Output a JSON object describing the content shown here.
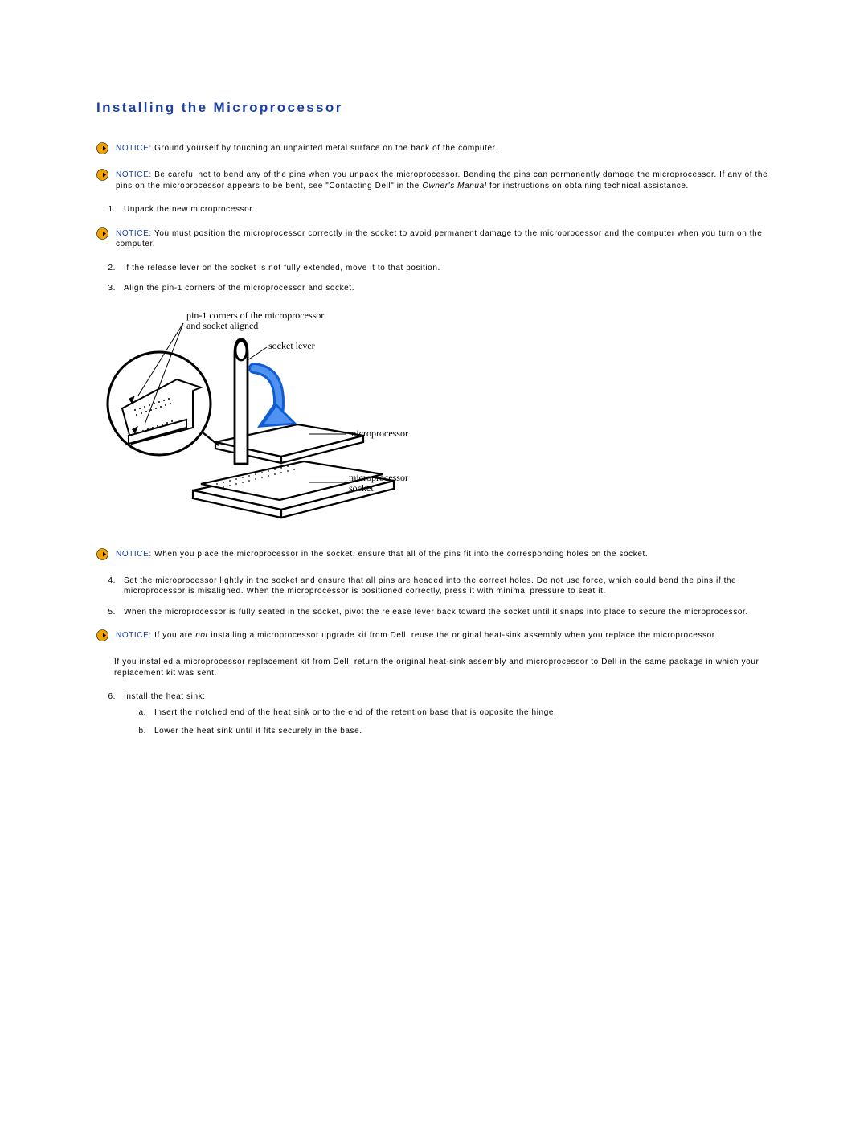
{
  "title": "Installing the Microprocessor",
  "notices": {
    "label": "NOTICE:",
    "n1": "Ground yourself by touching an unpainted metal surface on the back of the computer.",
    "n2_a": "Be careful not to bend any of the pins when you unpack the microprocessor. Bending the pins can permanently damage the microprocessor. If any of the pins on the microprocessor appears to be bent, see \"Contacting Dell\" in the ",
    "n2_em": "Owner's Manual",
    "n2_b": " for instructions on obtaining technical assistance.",
    "n3": "You must position the microprocessor correctly in the socket to avoid permanent damage to the microprocessor and the computer when you turn on the computer.",
    "n4": "When you place the microprocessor in the socket, ensure that all of the pins fit into the corresponding holes on the socket.",
    "n5_a": "If you are ",
    "n5_em": "not",
    "n5_b": " installing a microprocessor upgrade kit from Dell, reuse the original heat-sink assembly when you replace the microprocessor."
  },
  "steps": {
    "s1": {
      "n": "1.",
      "t": "Unpack the new microprocessor."
    },
    "s2": {
      "n": "2.",
      "t": "If the release lever on the socket is not fully extended, move it to that position."
    },
    "s3": {
      "n": "3.",
      "t": "Align the pin-1 corners of the microprocessor and socket."
    },
    "s4": {
      "n": "4.",
      "t": "Set the microprocessor lightly in the socket and ensure that all pins are headed into the correct holes. Do not use force, which could bend the pins if the microprocessor is misaligned. When the microprocessor is positioned correctly, press it with minimal pressure to seat it."
    },
    "s5": {
      "n": "5.",
      "t": "When the microprocessor is fully seated in the socket, pivot the release lever back toward the socket until it snaps into place to secure the microprocessor."
    },
    "s6": {
      "n": "6.",
      "t": "Install the heat sink:"
    },
    "s6a": {
      "n": "a.",
      "t": "Insert the notched end of the heat sink onto the end of the retention base that is opposite the hinge."
    },
    "s6b": {
      "n": "b.",
      "t": "Lower the heat sink until it fits securely in the base."
    }
  },
  "paragraph": "If you installed a microprocessor replacement kit from Dell, return the original heat-sink assembly and microprocessor to Dell in the same package in which your replacement kit was sent.",
  "diagram": {
    "label_pin1_a": "pin-1 corners of the microprocessor",
    "label_pin1_b": "and socket aligned",
    "label_lever": "socket lever",
    "label_proc": "microprocessor",
    "label_socket_a": "microprocessor",
    "label_socket_b": "socket"
  }
}
